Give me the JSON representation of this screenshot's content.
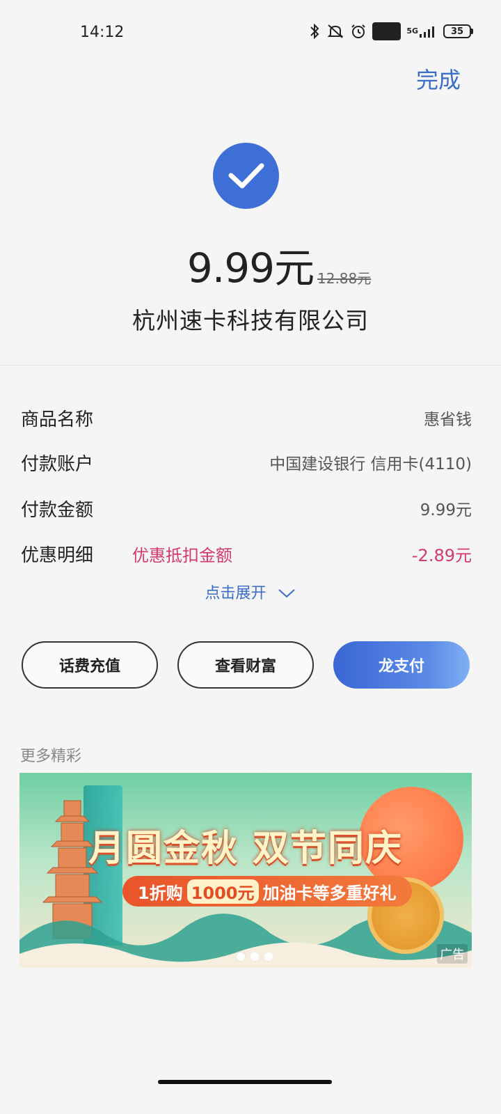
{
  "status_bar": {
    "time": "14:12",
    "network": "5G",
    "hd": "HD",
    "battery": "35"
  },
  "header": {
    "done_label": "完成"
  },
  "result": {
    "amount": "9.99元",
    "original_amount": "12.88元",
    "merchant": "杭州速卡科技有限公司"
  },
  "details": {
    "product": {
      "label": "商品名称",
      "value": "惠省钱"
    },
    "account": {
      "label": "付款账户",
      "value": "中国建设银行 信用卡(4110)"
    },
    "paid": {
      "label": "付款金额",
      "value": "9.99元"
    },
    "discount": {
      "label": "优惠明细",
      "desc": "优惠抵扣金额",
      "value": "-2.89元"
    },
    "expand_label": "点击展开"
  },
  "actions": {
    "recharge": "话费充值",
    "wealth": "查看财富",
    "longpay": "龙支付"
  },
  "more": {
    "title": "更多精彩",
    "banner": {
      "headline": "月圆金秋 双节同庆",
      "promo_prefix": "1折购",
      "promo_highlight": "1000元",
      "promo_suffix": "加油卡等多重好礼",
      "ad_label": "广告"
    }
  },
  "colors": {
    "accent_blue": "#3a6cc8",
    "check_blue": "#3d6fd6",
    "discount_red": "#d13a6a"
  }
}
